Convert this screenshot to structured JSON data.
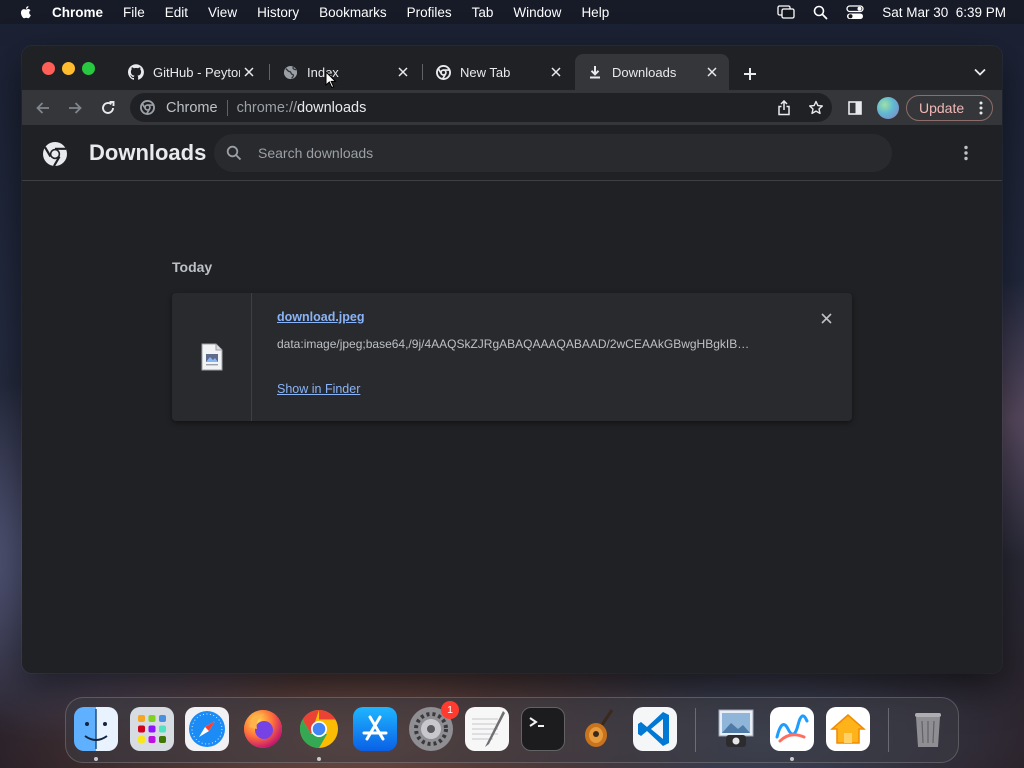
{
  "menubar": {
    "app_name": "Chrome",
    "menus": [
      "File",
      "Edit",
      "View",
      "History",
      "Bookmarks",
      "Profiles",
      "Tab",
      "Window",
      "Help"
    ],
    "clock": "Sat Mar 30  6:39 PM",
    "status_icons": [
      "screen-mirroring-icon",
      "spotlight-search-icon",
      "control-center-icon"
    ]
  },
  "tabs": [
    {
      "title": "GitHub - Peyton",
      "icon": "github-icon",
      "active": false
    },
    {
      "title": "Index",
      "icon": "globe-icon",
      "active": false
    },
    {
      "title": "New Tab",
      "icon": "chrome-icon",
      "active": false
    },
    {
      "title": "Downloads",
      "icon": "download-icon",
      "active": true
    }
  ],
  "toolbar": {
    "chip_label": "Chrome",
    "url_scheme": "chrome://",
    "url_host": "downloads",
    "update_label": "Update"
  },
  "downloads_page": {
    "title": "Downloads",
    "search_placeholder": "Search downloads",
    "date_group": "Today",
    "items": [
      {
        "file_name": "download.jpeg",
        "source_url": "data:image/jpeg;base64,/9j/4AAQSkZJRgABAQAAAQABAAD/2wCEAAkGBwgHBgkIB…",
        "action_label": "Show in Finder",
        "file_icon": "image-file-icon"
      }
    ]
  },
  "dock": {
    "apps": [
      "finder",
      "launchpad",
      "safari",
      "firefox",
      "chrome",
      "app-store",
      "system-settings",
      "textedit",
      "terminal",
      "garageband",
      "vscode",
      "preview",
      "freeform",
      "home",
      "trash"
    ],
    "settings_badge": "1"
  },
  "colors": {
    "accent_link": "#8ab4f8",
    "update_text": "#f2b8b5",
    "page_bg": "#202124",
    "toolbar_bg": "#35363a"
  }
}
